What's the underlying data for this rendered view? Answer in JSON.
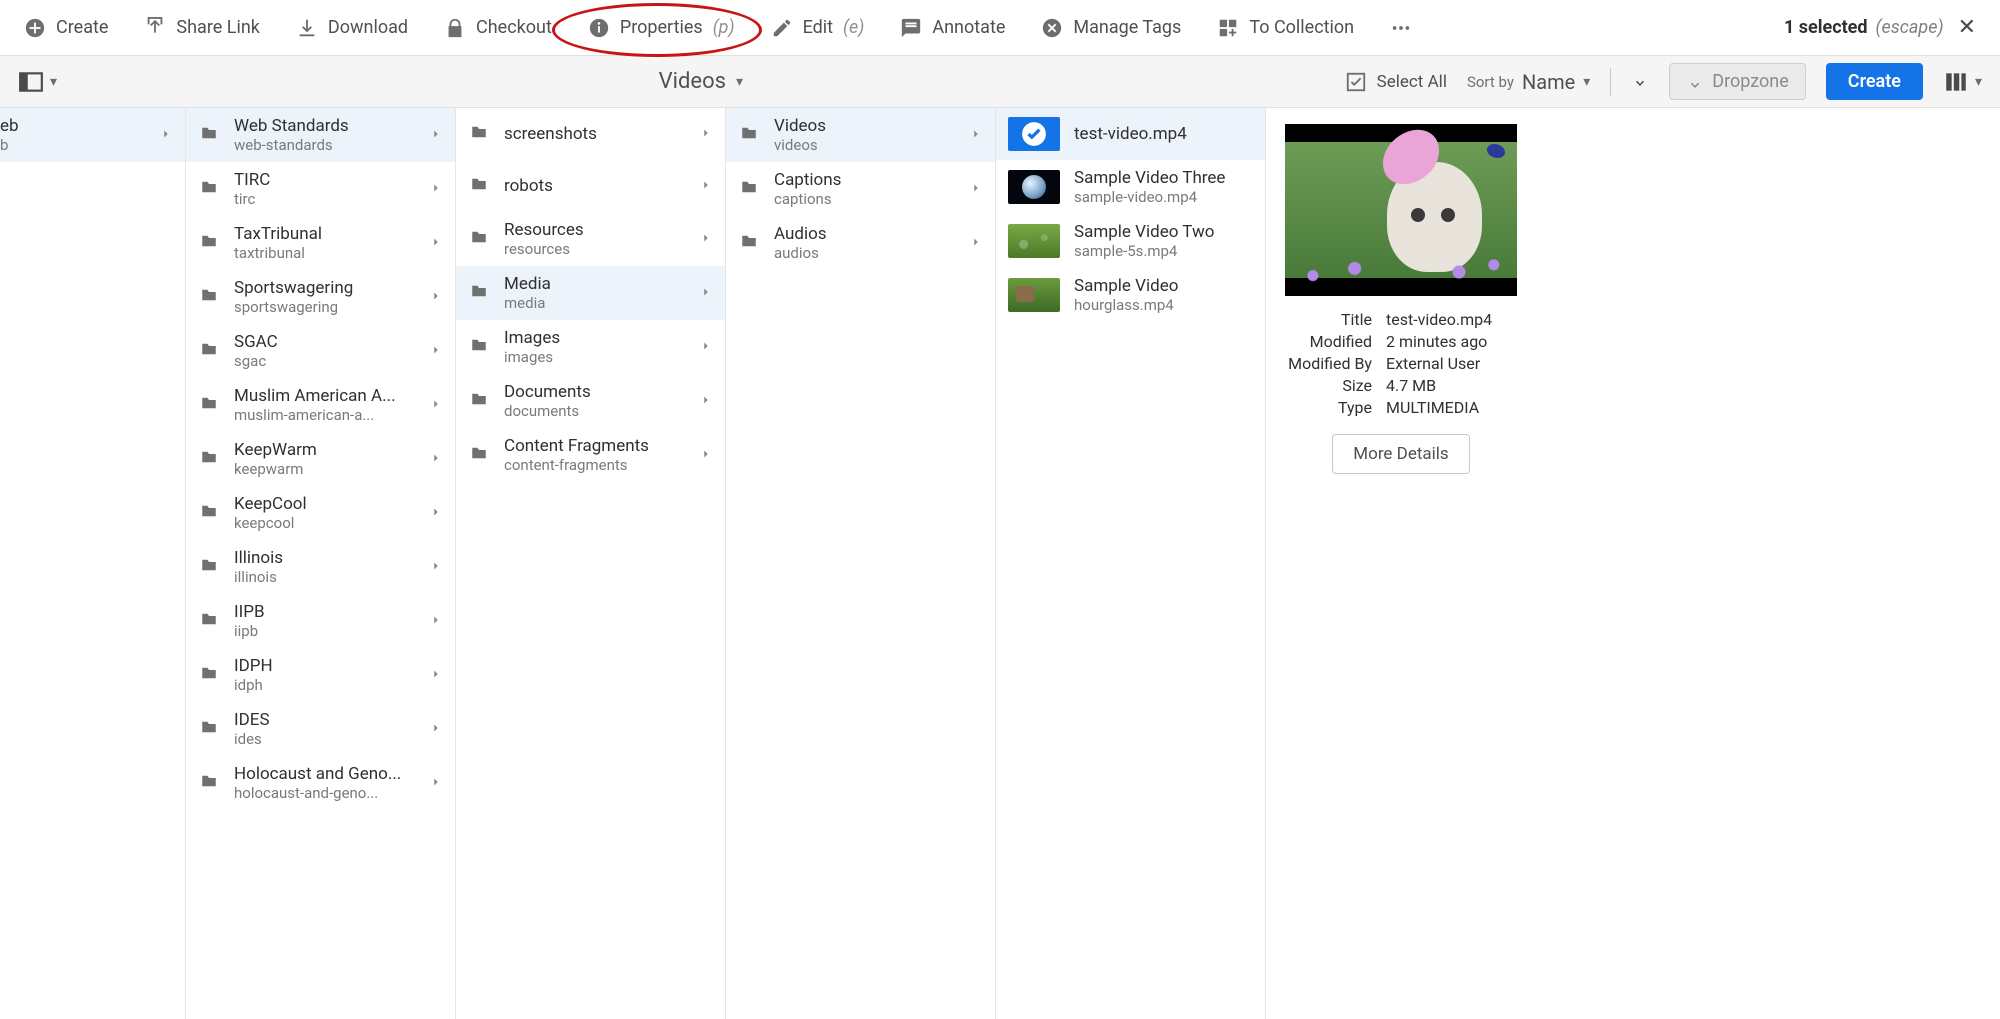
{
  "topbar": {
    "actions": [
      {
        "key": "create",
        "label": "Create",
        "icon": "plus-circle"
      },
      {
        "key": "share",
        "label": "Share Link",
        "icon": "share"
      },
      {
        "key": "download",
        "label": "Download",
        "icon": "download"
      },
      {
        "key": "checkout",
        "label": "Checkout",
        "icon": "lock"
      },
      {
        "key": "properties",
        "label": "Properties",
        "shortcut": "(p)",
        "icon": "info",
        "highlighted": true
      },
      {
        "key": "edit",
        "label": "Edit",
        "shortcut": "(e)",
        "icon": "pencil"
      },
      {
        "key": "annotate",
        "label": "Annotate",
        "icon": "note"
      },
      {
        "key": "managetags",
        "label": "Manage Tags",
        "icon": "tag"
      },
      {
        "key": "tocollection",
        "label": "To Collection",
        "icon": "collection"
      }
    ],
    "more": "...",
    "selected_count": "1 selected",
    "escape": "(escape)"
  },
  "secondbar": {
    "title": "Videos",
    "select_all": "Select All",
    "sort_by_label": "Sort by",
    "sort_by_value": "Name",
    "dropzone": "Dropzone",
    "create": "Create"
  },
  "columns": {
    "c0_partial": [
      {
        "t1": "eb",
        "t2": "b",
        "selected": true
      }
    ],
    "c1": [
      {
        "t1": "Web Standards",
        "t2": "web-standards",
        "selected": true
      },
      {
        "t1": "TIRC",
        "t2": "tirc"
      },
      {
        "t1": "TaxTribunal",
        "t2": "taxtribunal"
      },
      {
        "t1": "Sportswagering",
        "t2": "sportswagering"
      },
      {
        "t1": "SGAC",
        "t2": "sgac"
      },
      {
        "t1": "Muslim American A...",
        "t2": "muslim-american-a..."
      },
      {
        "t1": "KeepWarm",
        "t2": "keepwarm"
      },
      {
        "t1": "KeepCool",
        "t2": "keepcool"
      },
      {
        "t1": "Illinois",
        "t2": "illinois"
      },
      {
        "t1": "IIPB",
        "t2": "iipb"
      },
      {
        "t1": "IDPH",
        "t2": "idph"
      },
      {
        "t1": "IDES",
        "t2": "ides"
      },
      {
        "t1": "Holocaust and Geno...",
        "t2": "holocaust-and-geno..."
      }
    ],
    "c2": [
      {
        "t1": "screenshots",
        "t2": ""
      },
      {
        "t1": "robots",
        "t2": ""
      },
      {
        "t1": "Resources",
        "t2": "resources"
      },
      {
        "t1": "Media",
        "t2": "media",
        "selected": true
      },
      {
        "t1": "Images",
        "t2": "images"
      },
      {
        "t1": "Documents",
        "t2": "documents"
      },
      {
        "t1": "Content Fragments",
        "t2": "content-fragments"
      }
    ],
    "c3": [
      {
        "t1": "Videos",
        "t2": "videos",
        "selected": true
      },
      {
        "t1": "Captions",
        "t2": "captions"
      },
      {
        "t1": "Audios",
        "t2": "audios"
      }
    ],
    "c4": [
      {
        "t1": "test-video.mp4",
        "t2": "",
        "thumb": "selcheck",
        "selected": true
      },
      {
        "t1": "Sample Video Three",
        "t2": "sample-video.mp4",
        "thumb": "moon"
      },
      {
        "t1": "Sample Video Two",
        "t2": "sample-5s.mp4",
        "thumb": "forest"
      },
      {
        "t1": "Sample Video",
        "t2": "hourglass.mp4",
        "thumb": "green"
      }
    ]
  },
  "detail": {
    "meta": [
      {
        "k": "Title",
        "v": "test-video.mp4"
      },
      {
        "k": "Modified",
        "v": "2 minutes ago"
      },
      {
        "k": "Modified By",
        "v": "External User"
      },
      {
        "k": "Size",
        "v": "4.7 MB"
      },
      {
        "k": "Type",
        "v": "MULTIMEDIA"
      }
    ],
    "more": "More Details"
  }
}
